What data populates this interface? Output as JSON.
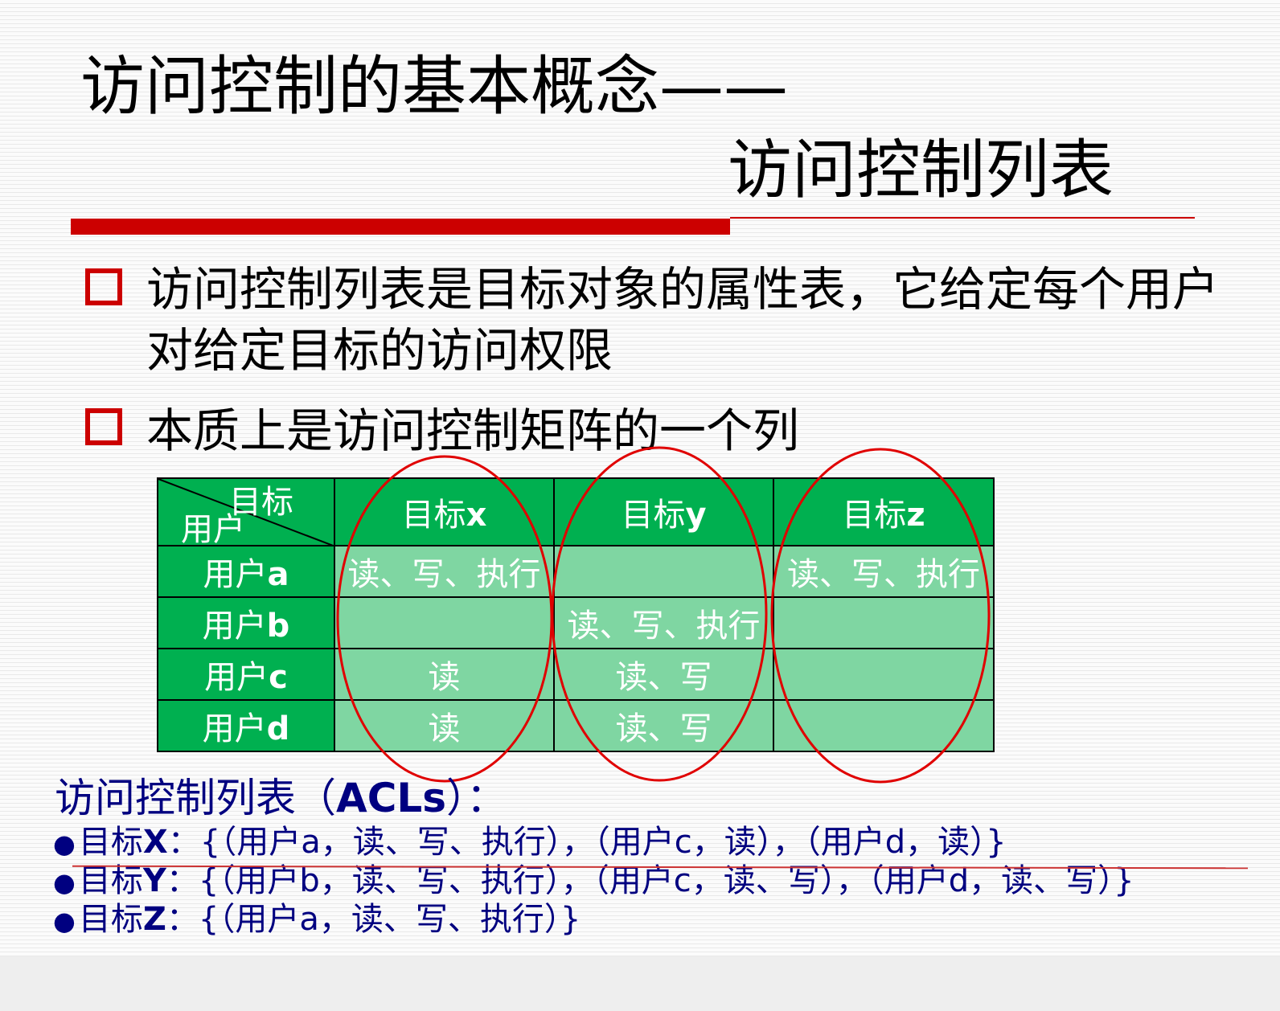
{
  "title": {
    "line1": "访问控制的基本概念——",
    "line2": "访问控制列表"
  },
  "points": [
    "访问控制列表是目标对象的属性表，它给定每个用户对给定目标的访问权限",
    "本质上是访问控制矩阵的一个列"
  ],
  "matrix": {
    "corner_top": "目标",
    "corner_bottom": "用户",
    "columns": [
      {
        "prefix": "目标",
        "id": "x"
      },
      {
        "prefix": "目标",
        "id": "y"
      },
      {
        "prefix": "目标",
        "id": "z"
      }
    ],
    "rows": [
      {
        "prefix": "用户",
        "id": "a",
        "cells": [
          "读、写、执行",
          "",
          "读、写、执行"
        ]
      },
      {
        "prefix": "用户",
        "id": "b",
        "cells": [
          "",
          "读、写、执行",
          ""
        ]
      },
      {
        "prefix": "用户",
        "id": "c",
        "cells": [
          "读",
          "读、写",
          ""
        ]
      },
      {
        "prefix": "用户",
        "id": "d",
        "cells": [
          "读",
          "读、写",
          ""
        ]
      }
    ]
  },
  "acl": {
    "heading_pre": "访问控制列表（",
    "heading_bold": "ACLs",
    "heading_post": "）：",
    "lines": [
      {
        "bullet": "●",
        "label": "目标",
        "id": "X",
        "text": "：{（用户a，读、写、执行），（用户c，读），（用户d，读）}"
      },
      {
        "bullet": "●",
        "label": "目标",
        "id": "Y",
        "text": "：{（用户b，读、写、执行），（用户c，读、写），（用户d，读、写）}"
      },
      {
        "bullet": "●",
        "label": "目标",
        "id": "Z",
        "text": "：{（用户a，读、写、执行）}"
      }
    ]
  },
  "colors": {
    "accent_red": "#cc0000",
    "header_green": "#00b050",
    "cell_green": "#7fd6a2",
    "acl_navy": "#000080"
  }
}
